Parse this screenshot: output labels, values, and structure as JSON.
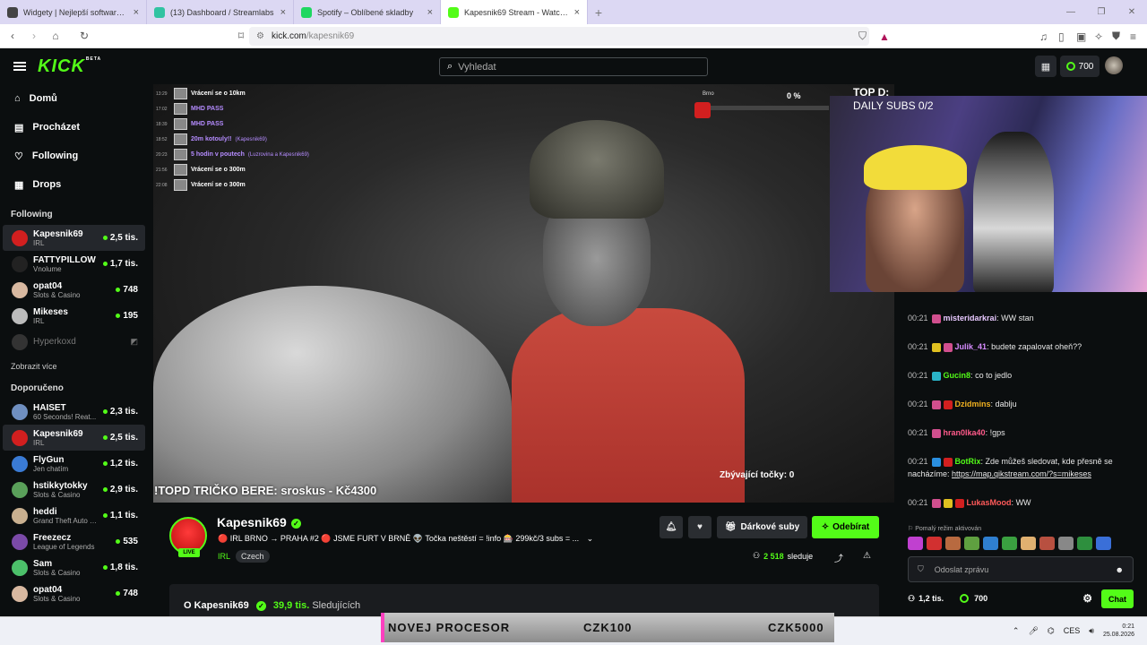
{
  "browser": {
    "tabs": [
      {
        "title": "Widgety | Nejlepší software pro vyle...",
        "color": "#444444",
        "active": false
      },
      {
        "title": "(13) Dashboard / Streamlabs",
        "color": "#31c3a2",
        "active": false
      },
      {
        "title": "Spotify – Oblíbené skladby",
        "color": "#1ed760",
        "active": false
      },
      {
        "title": "Kapesnik69 Stream - Watch L...",
        "color": "#53fc18",
        "active": true
      }
    ],
    "url_host": "kick.com",
    "url_path": "/kapesnik69"
  },
  "topnav": {
    "logo": "KICK",
    "beta": "BETA",
    "search_placeholder": "Vyhledat",
    "points": "700"
  },
  "sidebar": {
    "nav": [
      {
        "label": "Domů",
        "icon": "home-icon",
        "glyph": "⌂"
      },
      {
        "label": "Procházet",
        "icon": "browse-icon",
        "glyph": "▤"
      },
      {
        "label": "Following",
        "icon": "heart-icon",
        "glyph": "♡"
      },
      {
        "label": "Drops",
        "icon": "drops-icon",
        "glyph": "▦"
      }
    ],
    "following_title": "Following",
    "following": [
      {
        "name": "Kapesnik69",
        "category": "IRL",
        "viewers": "2,5 tis.",
        "color": "#d21f1f",
        "selected": true,
        "offline": false
      },
      {
        "name": "FATTYPILLOW",
        "category": "Vnolume",
        "viewers": "1,7 tis.",
        "color": "#222222",
        "selected": false,
        "offline": false
      },
      {
        "name": "opat04",
        "category": "Slots & Casino",
        "viewers": "748",
        "color": "#d8b8a0",
        "selected": false,
        "offline": false
      },
      {
        "name": "Mikeses",
        "category": "IRL",
        "viewers": "195",
        "color": "#bcbcbc",
        "selected": false,
        "offline": false
      },
      {
        "name": "Hyperkoxd",
        "category": "",
        "viewers": "",
        "color": "#333333",
        "selected": false,
        "offline": true
      }
    ],
    "show_more": "Zobrazit více",
    "recommended_title": "Doporučeno",
    "recommended": [
      {
        "name": "HAISET",
        "category": "60 Seconds! Reat...",
        "viewers": "2,3 tis.",
        "color": "#6f8fc0",
        "selected": false
      },
      {
        "name": "Kapesnik69",
        "category": "IRL",
        "viewers": "2,5 tis.",
        "color": "#d21f1f",
        "selected": true
      },
      {
        "name": "FlyGun",
        "category": "Jen chatím",
        "viewers": "1,2 tis.",
        "color": "#3a7bd5",
        "selected": false
      },
      {
        "name": "hstikkytokky",
        "category": "Slots & Casino",
        "viewers": "2,9 tis.",
        "color": "#5aa05a",
        "selected": false
      },
      {
        "name": "heddi",
        "category": "Grand Theft Auto V ...",
        "viewers": "1,1 tis.",
        "color": "#c9b090",
        "selected": false
      },
      {
        "name": "Freezecz",
        "category": "League of Legends",
        "viewers": "535",
        "color": "#7b4aa8",
        "selected": false
      },
      {
        "name": "Sam",
        "category": "Slots & Casino",
        "viewers": "1,8 tis.",
        "color": "#4cc06a",
        "selected": false
      },
      {
        "name": "opat04",
        "category": "Slots & Casino",
        "viewers": "748",
        "color": "#d8b8a0",
        "selected": false
      }
    ]
  },
  "video": {
    "feed": [
      {
        "time": "13:29",
        "text": "Vrácení se o 10km",
        "by": "",
        "purple": false
      },
      {
        "time": "17:02",
        "text": "MHD PASS",
        "by": "",
        "purple": true
      },
      {
        "time": "18:39",
        "text": "MHD PASS",
        "by": "",
        "purple": true
      },
      {
        "time": "18:52",
        "text": "20m kotouly!!",
        "by": "(Kapesnik69)",
        "purple": true
      },
      {
        "time": "20:23",
        "text": "5 hodin v poutech",
        "by": "(Luzrovina a Kapesnik69)",
        "purple": true
      },
      {
        "time": "21:56",
        "text": "Vrácení se o 300m",
        "by": "",
        "purple": false
      },
      {
        "time": "22:08",
        "text": "Vrácení se o 300m",
        "by": "",
        "purple": false
      }
    ],
    "goal_label": "Brno",
    "goal_percent": "0 %",
    "ticker": "!TOPD TRIČKO BERE: sroskus - Kč4300",
    "remaining": "Zbývající točky: 0",
    "overlay_title": "TOP D:",
    "overlay_sub": "DAILY SUBS 0/2"
  },
  "channel": {
    "name": "Kapesnik69",
    "live": "LIVE",
    "stream_title": "🔴 IRL BRNO → PRAHA #2 🔴 JSME FURT V BRNĚ 👽 Točka neštěstí = !info 🎰 299kč/3 subs = ...",
    "category": "IRL",
    "tag": "Czech",
    "gift_label": "Dárkové suby",
    "follow_label": "Odebírat",
    "followers_count": "2 518",
    "followers_label": "sleduje",
    "about_prefix": "O Kapesnik69",
    "about_count": "39,9 tis.",
    "about_label": "Sledujících"
  },
  "chat": {
    "messages": [
      {
        "time": "00:21",
        "badges": [
          "#d14f8e"
        ],
        "user": "misteridarkrai",
        "color": "#e8c8ff",
        "text": "WW stan"
      },
      {
        "time": "00:21",
        "badges": [
          "#e0c020",
          "#d14f8e"
        ],
        "user": "Julik_41",
        "color": "#d78cff",
        "text": "budete zapalovat oheň??"
      },
      {
        "time": "00:21",
        "badges": [
          "#2ab4c8"
        ],
        "user": "Gucin8",
        "color": "#53fc18",
        "text": "co to jedlo"
      },
      {
        "time": "00:21",
        "badges": [
          "#d14f8e",
          "#d21f1f"
        ],
        "user": "Dzidmins",
        "color": "#f0b020",
        "text": "dablju"
      },
      {
        "time": "00:21",
        "badges": [
          "#d14f8e"
        ],
        "user": "hran0lka40",
        "color": "#ff5a8a",
        "text": "!gps"
      },
      {
        "time": "00:21",
        "badges": [
          "#2a8fe0",
          "#d21f1f"
        ],
        "user": "BotRix",
        "color": "#53fc18",
        "text": "Zde můžeš sledovat, kde přesně se nacházíme: ",
        "link": "https://map.qikstream.com/?s=mikeses"
      },
      {
        "time": "00:21",
        "badges": [
          "#d14f8e",
          "#e0c020",
          "#d21f1f"
        ],
        "user": "LukasMood",
        "color": "#ff5a5a",
        "text": "WW"
      }
    ],
    "slow_mode": "Pomalý režim aktivován",
    "input_placeholder": "Odoslat zprávu",
    "viewer_count": "1,2 tis.",
    "points": "700",
    "chat_button": "Chat"
  },
  "taskbar": {
    "banner_left": "NOVEJ PROCESOR",
    "banner_mid": "CZK100",
    "banner_right": "CZK5000",
    "lang": "CES",
    "time": "0:21",
    "date": "25.08.2026"
  }
}
